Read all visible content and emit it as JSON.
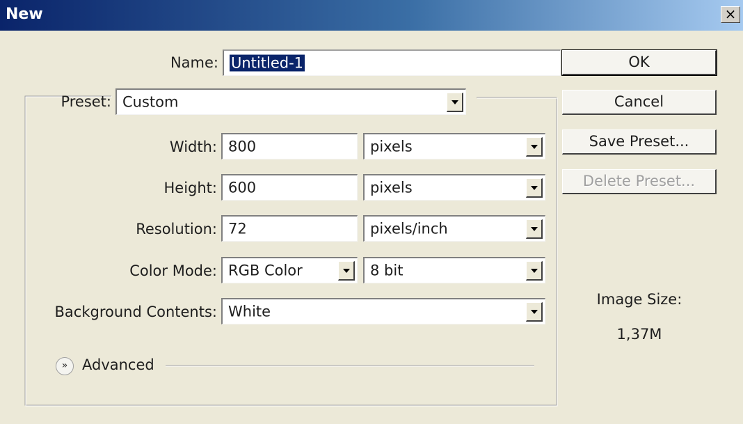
{
  "window": {
    "title": "New",
    "close_glyph": "×"
  },
  "form": {
    "name_label": "Name:",
    "name_value": "Untitled-1",
    "preset_label": "Preset:",
    "preset_value": "Custom",
    "width_label": "Width:",
    "width_value": "800",
    "width_unit": "pixels",
    "height_label": "Height:",
    "height_value": "600",
    "height_unit": "pixels",
    "resolution_label": "Resolution:",
    "resolution_value": "72",
    "resolution_unit": "pixels/inch",
    "color_mode_label": "Color Mode:",
    "color_mode_value": "RGB Color",
    "bit_depth_value": "8 bit",
    "background_label": "Background Contents:",
    "background_value": "White",
    "advanced_label": "Advanced",
    "advanced_icon": "chevron-double-down-icon"
  },
  "buttons": {
    "ok": "OK",
    "cancel": "Cancel",
    "save_preset": "Save Preset...",
    "delete_preset": "Delete Preset..."
  },
  "info": {
    "image_size_label": "Image Size:",
    "image_size_value": "1,37M"
  },
  "colors": {
    "title_start": "#0a246a",
    "title_end": "#a6caf0",
    "dialog_bg": "#ece9d8",
    "selection": "#0a246a"
  }
}
